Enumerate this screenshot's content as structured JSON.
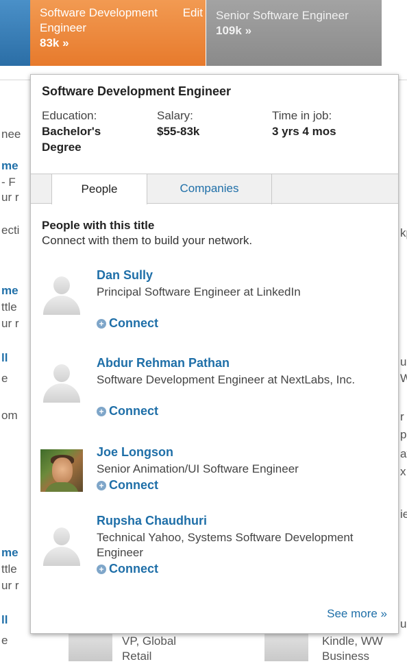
{
  "career_path": {
    "current": {
      "title": "Software Development Engineer",
      "salary": "83k",
      "arrow": "»",
      "edit_label": "Edit"
    },
    "next": {
      "title": "Senior Software Engineer",
      "salary": "109k",
      "arrow": "»"
    }
  },
  "background": {
    "fragments": [
      "nee",
      "me",
      "- F",
      "ur r",
      "ecti",
      "me",
      "ttle",
      "ur r",
      "ll",
      "e",
      "om",
      "me",
      "ttle",
      "ur r",
      "ll",
      "e",
      "kp",
      "u",
      "W",
      "r",
      "p",
      "at",
      "x",
      "ie",
      "u"
    ],
    "bottom_left_text": [
      "VP, Global",
      "Retail"
    ],
    "bottom_right_text": [
      "Kindle, WW",
      "Business"
    ]
  },
  "popup": {
    "title": "Software Development Engineer",
    "education": {
      "label": "Education:",
      "value": "Bachelor's Degree"
    },
    "salary": {
      "label": "Salary:",
      "value": "$55-83k"
    },
    "time_in_job": {
      "label": "Time in job:",
      "value": "3 yrs 4 mos"
    },
    "tabs": [
      {
        "label": "People",
        "active": true
      },
      {
        "label": "Companies",
        "active": false
      }
    ],
    "section_title": "People with this title",
    "section_subtitle": "Connect with them to build your network.",
    "people": [
      {
        "name": "Dan Sully",
        "headline": "Principal Software Engineer at LinkedIn",
        "connect_label": "Connect",
        "avatar": "silhouette"
      },
      {
        "name": "Abdur Rehman Pathan",
        "headline": "Software Development Engineer at NextLabs, Inc.",
        "connect_label": "Connect",
        "avatar": "silhouette"
      },
      {
        "name": "Joe Longson",
        "headline": "Senior Animation/UI Software Engineer",
        "connect_label": "Connect",
        "avatar": "photo"
      },
      {
        "name": "Rupsha Chaudhuri",
        "headline": "Technical Yahoo, Systems Software Development Engineer",
        "connect_label": "Connect",
        "avatar": "silhouette"
      }
    ],
    "see_more": "See more »"
  },
  "colors": {
    "accent_orange": "#e77a2c",
    "link_blue": "#1f6fa8",
    "inactive_gray": "#8a8a8a",
    "top_blue": "#2b6ea6"
  },
  "icons": {
    "connect": "plus-circle-icon",
    "default_avatar": "person-silhouette-icon"
  }
}
